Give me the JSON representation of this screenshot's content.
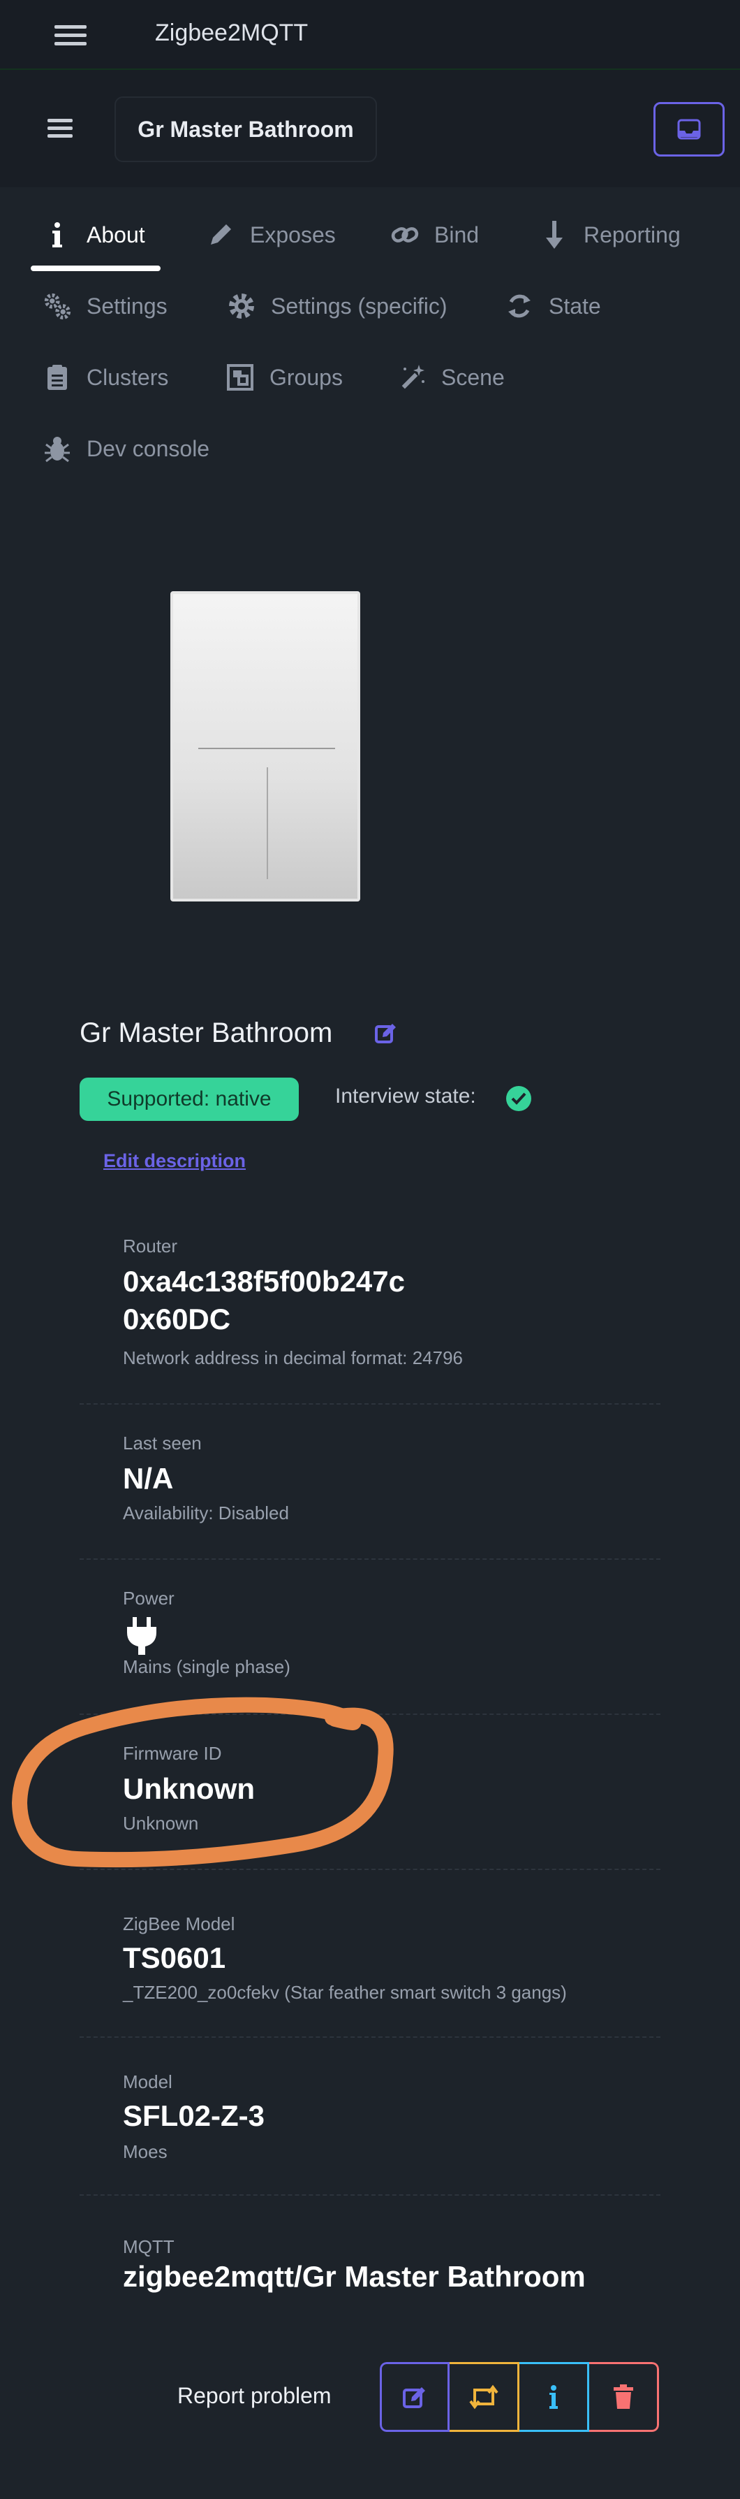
{
  "app": {
    "title": "Zigbee2MQTT"
  },
  "device": {
    "name_field": "Gr Master Bathroom"
  },
  "tabs": [
    {
      "label": "About",
      "icon": "info-icon"
    },
    {
      "label": "Exposes",
      "icon": "pencil-icon"
    },
    {
      "label": "Bind",
      "icon": "link-icon"
    },
    {
      "label": "Reporting",
      "icon": "arrow-down-icon"
    },
    {
      "label": "Settings",
      "icon": "gears-icon"
    },
    {
      "label": "Settings (specific)",
      "icon": "gear-icon"
    },
    {
      "label": "State",
      "icon": "sync-icon"
    },
    {
      "label": "Clusters",
      "icon": "clipboard-icon"
    },
    {
      "label": "Groups",
      "icon": "object-group-icon"
    },
    {
      "label": "Scene",
      "icon": "magic-wand-icon"
    },
    {
      "label": "Dev console",
      "icon": "bug-icon"
    }
  ],
  "about": {
    "heading": "Gr Master Bathroom",
    "support_badge": "Supported: native",
    "interview_label": "Interview state:",
    "edit_description": "Edit description",
    "cards": [
      {
        "label": "Router",
        "value": "0xa4c138f5f00b247c",
        "value2": "0x60DC",
        "sub": "Network address in decimal format: 24796"
      },
      {
        "label": "Last seen",
        "value": "N/A",
        "sub": "Availability: Disabled"
      },
      {
        "label": "Power",
        "icon": "plug-icon",
        "sub": "Mains (single phase)"
      },
      {
        "label": "Firmware ID",
        "value": "Unknown",
        "sub": "Unknown"
      },
      {
        "label": "ZigBee Model",
        "value": "TS0601",
        "sub": "_TZE200_zo0cfekv (Star feather smart switch 3 gangs)"
      },
      {
        "label": "Model",
        "value": "SFL02-Z-3",
        "sub": "Moes"
      },
      {
        "label": "MQTT",
        "value": "zigbee2mqtt/Gr Master Bathroom"
      }
    ]
  },
  "footer": {
    "report_label": "Report problem"
  },
  "colors": {
    "accent": "#6b63e6",
    "success": "#36d399",
    "warning": "#f0b43c",
    "info": "#3abff8",
    "error": "#f87272",
    "annotation": "#e8894a"
  }
}
